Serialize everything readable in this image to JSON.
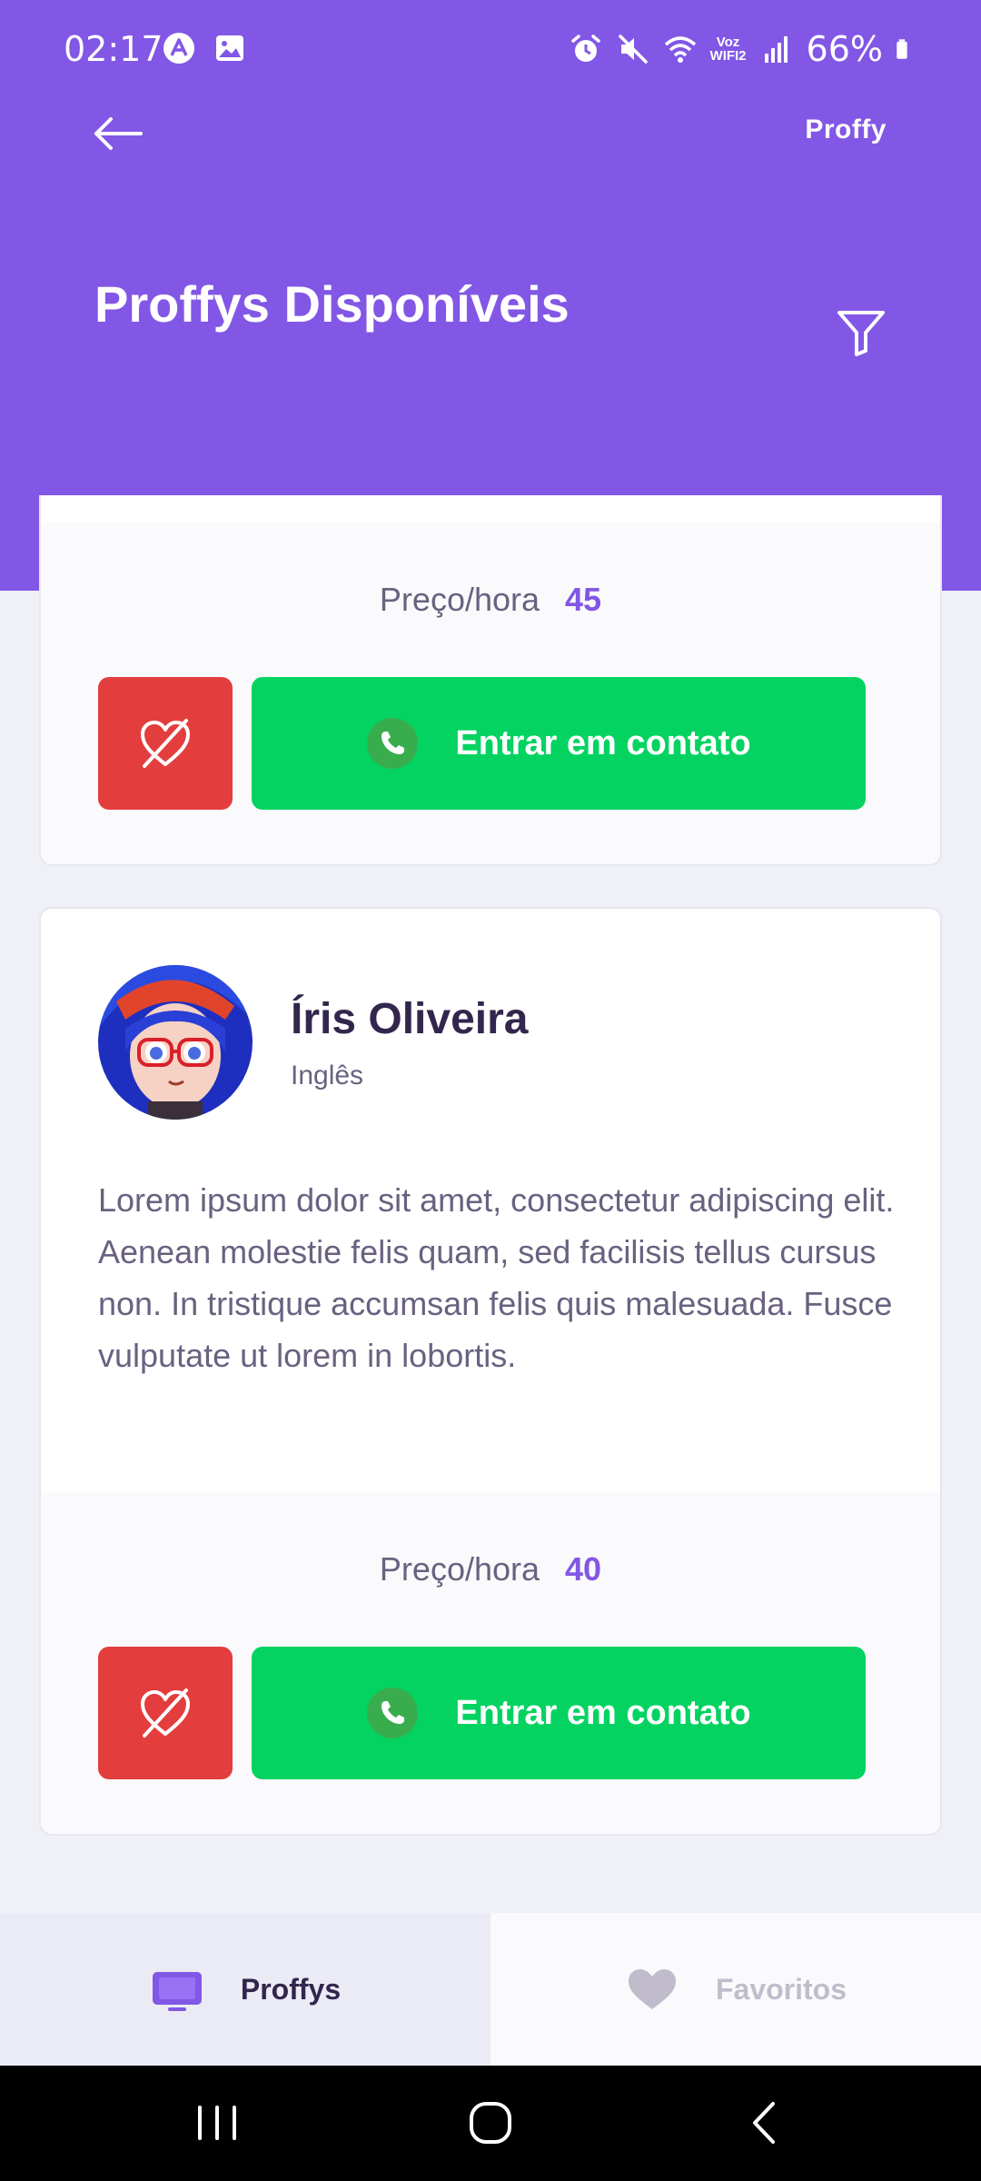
{
  "status_bar": {
    "time": "02:17",
    "voz_line1": "Voz",
    "voz_line2": "WIFI2",
    "battery": "66%"
  },
  "header": {
    "brand": "Proffy",
    "title": "Proffys Disponíveis",
    "accent_color": "#8257E5"
  },
  "cards": [
    {
      "price_label": "Preço/hora",
      "price_value": "45",
      "contact_label": "Entrar em contato"
    },
    {
      "name": "Íris Oliveira",
      "subject": "Inglês",
      "bio": "Lorem ipsum dolor sit amet, consectetur adipiscing elit. Aenean molestie felis quam, sed facilisis tellus cursus non. In tristique accumsan felis quis malesuada. Fusce vulputate ut lorem in lobortis.",
      "price_label": "Preço/hora",
      "price_value": "40",
      "contact_label": "Entrar em contato"
    }
  ],
  "tabs": [
    {
      "label": "Proffys",
      "icon": "tv-icon",
      "active": true
    },
    {
      "label": "Favoritos",
      "icon": "heart-icon",
      "active": false
    }
  ],
  "colors": {
    "primary": "#8257E5",
    "danger": "#E33D3D",
    "success": "#04D361"
  }
}
